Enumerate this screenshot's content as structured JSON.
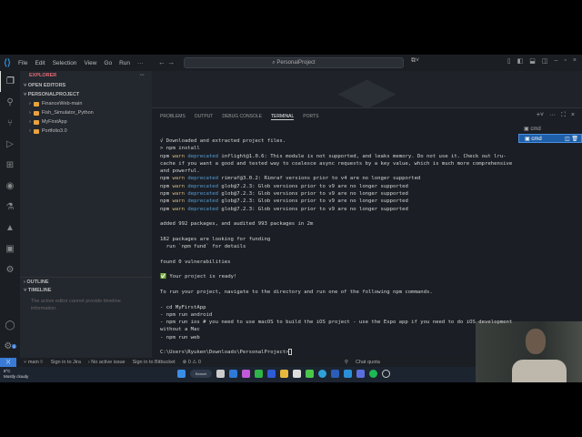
{
  "titlebar": {
    "menus": [
      "File",
      "Edit",
      "Selection",
      "View",
      "Go",
      "Run",
      "···"
    ],
    "search": "PersonalProject"
  },
  "sidebar": {
    "title": "EXPLORER",
    "more": "···",
    "open_editors": "OPEN EDITORS",
    "project": "PERSONALPROJECT",
    "folders": [
      "FinanceWeb-main",
      "Fish_Simulator_Python",
      "MyFirstApp",
      "Portfolio3.0"
    ],
    "outline": "OUTLINE",
    "timeline": "TIMELINE",
    "timeline_msg": "The active editor cannot provide timeline information."
  },
  "panel": {
    "tabs": [
      "PROBLEMS",
      "OUTPUT",
      "DEBUG CONSOLE",
      "TERMINAL",
      "PORTS"
    ],
    "active_tab": "TERMINAL",
    "terminals": [
      "cmd",
      "cmd"
    ]
  },
  "terminal": {
    "l1": "√ Downloaded and extracted project files.",
    "l2": "> npm install",
    "warn_prefix": "npm ",
    "warn": "warn",
    "dep": "deprecated",
    "w1": " inflight@1.0.6: This module is not supported, and leaks memory. Do not use it. Check out lru-cache if you want a good and tested way to coalesce async requests by a key value, which is much more comprehensive and powerful.",
    "w2": " rimraf@3.0.2: Rimraf versions prior to v4 are no longer supported",
    "w3": " glob@7.2.3: Glob versions prior to v9 are no longer supported",
    "l3": "added 992 packages, and audited 993 packages in 2m",
    "l4": "182 packages are looking for funding",
    "l5": "  run `npm fund` for details",
    "l6": "found 0 vulnerabilities",
    "l7": "✅ Your project is ready!",
    "l8": "To run your project, navigate to the directory and run one of the following npm commands.",
    "l9": "- cd MyFirstApp",
    "l10": "- npm run android",
    "l11": "- npm run ios # you need to use macOS to build the iOS project - use the Expo app if you need to do iOS development without a Mac",
    "l12": "- npm run web",
    "prompt": "C:\\Users\\Ryuken\\Downloads\\PersonalProject>"
  },
  "status": {
    "branch": "main",
    "jira": "Sign in to Jira",
    "issue": "No active issue",
    "bitbucket": "Sign in to Bitbucket",
    "problems": "⊗ 0 ⚠ 0",
    "chat": "Chat quota",
    "settings_badge": "1"
  },
  "taskbar": {
    "temp": "8°C",
    "weather": "Mostly cloudy",
    "search": "Search"
  }
}
